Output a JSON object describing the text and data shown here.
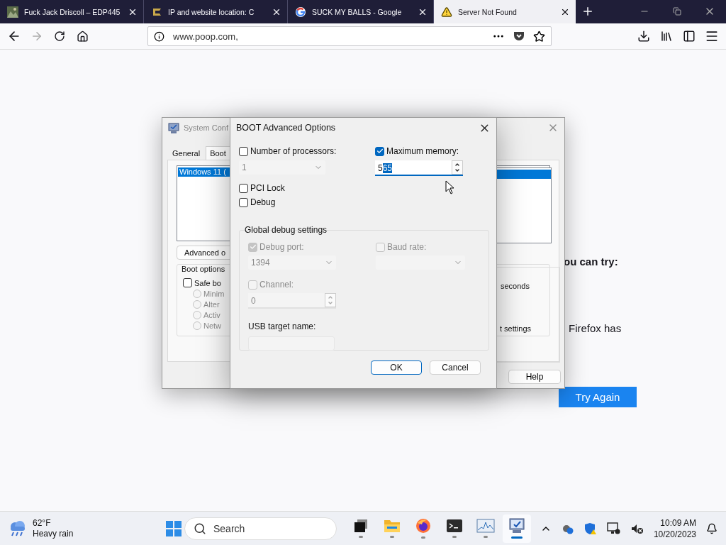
{
  "browser": {
    "tabs": [
      {
        "label": "Fuck Jack Driscoll – EDP445",
        "selected": false
      },
      {
        "label": "IP and website location: C",
        "selected": false
      },
      {
        "label": "SUCK MY BALLS - Google",
        "selected": false
      },
      {
        "label": "Server Not Found",
        "selected": true
      }
    ],
    "url": "www.poop.com,"
  },
  "page": {
    "heading_fragment": "ou can try:",
    "text_fragment": "Firefox has",
    "try_again_button": "Try Again"
  },
  "system_config": {
    "title": "System Conf",
    "tabs": [
      {
        "label": "General",
        "selected": false
      },
      {
        "label": "Boot",
        "selected": true
      }
    ],
    "boot_entries": [
      {
        "label": "Windows 11 (",
        "selected": true
      }
    ],
    "advanced_button": "Advanced o",
    "boot_options": {
      "title": "Boot options",
      "safe_boot": {
        "label": "Safe bo",
        "checked": false
      },
      "modes": [
        {
          "label": "Minim",
          "selected": false
        },
        {
          "label": "Alter",
          "selected": false
        },
        {
          "label": "Activ",
          "selected": false
        },
        {
          "label": "Netw",
          "selected": false
        }
      ]
    },
    "timeout_unit": "seconds",
    "permanent_fragment": "t settings",
    "help_button": "Help"
  },
  "dialog": {
    "title": "BOOT Advanced Options",
    "processors": {
      "label": "Number of processors:",
      "checked": false,
      "value": "1"
    },
    "memory": {
      "label": "Maximum memory:",
      "checked": true,
      "value_plain": "5",
      "value_selected": "65"
    },
    "pci_lock": {
      "label": "PCI Lock",
      "checked": false
    },
    "debug": {
      "label": "Debug",
      "checked": false
    },
    "debug_settings": {
      "title": "Global debug settings",
      "debug_port": {
        "label": "Debug port:",
        "checked": true,
        "value": "1394"
      },
      "baud_rate": {
        "label": "Baud rate:",
        "checked": false
      },
      "channel": {
        "label": "Channel:",
        "checked": false,
        "value": "0"
      },
      "usb_target": {
        "label": "USB target name:"
      }
    },
    "buttons": [
      {
        "label": "OK",
        "default": true
      },
      {
        "label": "Cancel",
        "default": false
      }
    ]
  },
  "taskbar": {
    "weather": {
      "temperature": "62°F",
      "condition": "Heavy rain"
    },
    "search_placeholder": "Search",
    "apps": [
      {
        "kind": "task-view",
        "selected": false
      },
      {
        "kind": "folder",
        "selected": false
      },
      {
        "kind": "firefox",
        "selected": false
      },
      {
        "kind": "terminal",
        "selected": false
      },
      {
        "kind": "monitor",
        "selected": false
      },
      {
        "kind": "sysconfig",
        "selected": true
      }
    ],
    "clock": {
      "time": "10:09 AM",
      "date": "10/20/2023"
    }
  }
}
